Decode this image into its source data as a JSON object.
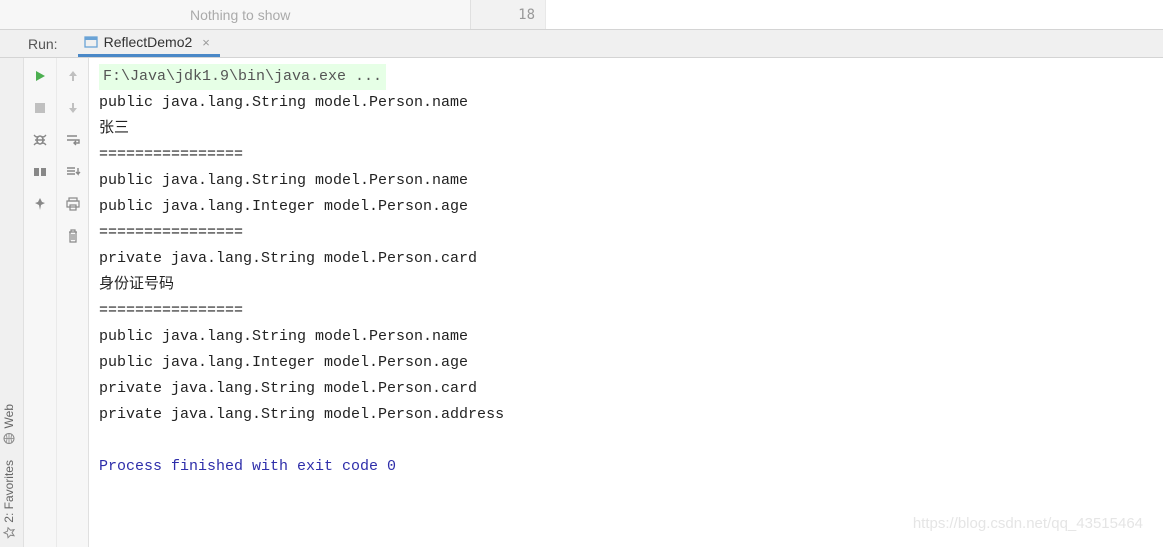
{
  "top": {
    "placeholder_text": "Nothing to show",
    "line_number": "18"
  },
  "run_panel": {
    "label": "Run:",
    "tab_name": "ReflectDemo2"
  },
  "side_tabs": {
    "web": "Web",
    "favorites": "2: Favorites"
  },
  "toolbar": {
    "run": "run-icon",
    "stop": "stop-icon",
    "debug": "debug-icon",
    "layout": "layout-icon",
    "pin": "pin-icon",
    "up": "up-icon",
    "down": "down-icon",
    "wrap": "wrap-icon",
    "scroll": "scroll-icon",
    "print": "print-icon",
    "trash": "trash-icon"
  },
  "console": {
    "command": "F:\\Java\\jdk1.9\\bin\\java.exe ...",
    "lines": [
      "public java.lang.String model.Person.name",
      "张三",
      "================",
      "public java.lang.String model.Person.name",
      "public java.lang.Integer model.Person.age",
      "================",
      "private java.lang.String model.Person.card",
      "身份证号码",
      "================",
      "public java.lang.String model.Person.name",
      "public java.lang.Integer model.Person.age",
      "private java.lang.String model.Person.card",
      "private java.lang.String model.Person.address"
    ],
    "exit": "Process finished with exit code 0"
  },
  "watermark": "https://blog.csdn.net/qq_43515464"
}
